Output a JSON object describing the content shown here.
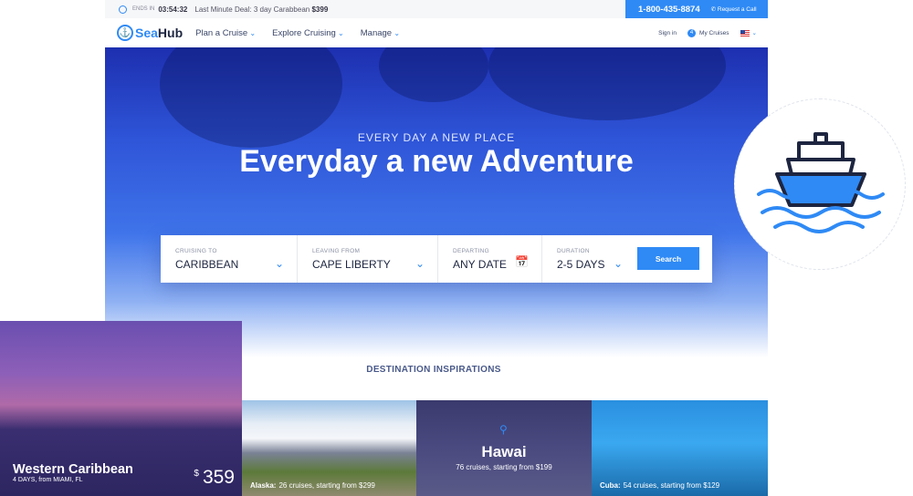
{
  "topbar": {
    "ends_label": "ENDS IN",
    "countdown": "03:54:32",
    "deal_text": "Last Minute Deal: 3 day Carabbean",
    "deal_price": "$399",
    "phone": "1-800-435-8874",
    "request_call": "Request a Call"
  },
  "nav": {
    "logo": {
      "sea": "Sea",
      "hub": "Hub"
    },
    "items": [
      {
        "label": "Plan a Cruise"
      },
      {
        "label": "Explore Cruising"
      },
      {
        "label": "Manage"
      }
    ],
    "sign_in": "Sign in",
    "my_cruises": "My Cruises",
    "cruise_count": "4"
  },
  "hero": {
    "kicker": "EVERY DAY A NEW PLACE",
    "title": "Everyday a new Adventure"
  },
  "search": {
    "fields": [
      {
        "label": "CRUISING TO",
        "value": "CARIBBEAN"
      },
      {
        "label": "LEAVING FROM",
        "value": "CAPE LIBERTY"
      },
      {
        "label": "DEPARTING",
        "value": "ANY DATE"
      },
      {
        "label": "DURATION",
        "value": "2-5 DAYS"
      }
    ],
    "button": "Search"
  },
  "section_title": "DESTINATION INSPIRATIONS",
  "featured": {
    "title": "Western Caribbean",
    "subtitle": "4 DAYS, from MIAMI, FL",
    "currency": "$",
    "price": "359"
  },
  "cards": [
    {
      "name": "Alaska:",
      "text": "26 cruises, starting from $299"
    },
    {
      "name": "Hawai",
      "text": "76 cruises, starting from $199"
    },
    {
      "name": "Cuba:",
      "text": "54 cruises, starting from $129"
    }
  ],
  "colors": {
    "accent": "#2f8af5",
    "navy": "#1d2540"
  }
}
